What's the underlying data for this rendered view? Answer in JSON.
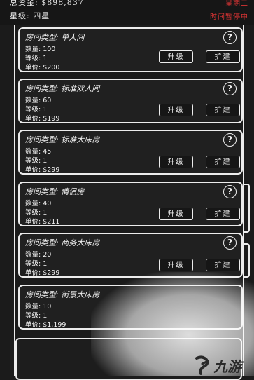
{
  "header": {
    "total_assets": "总资金: $898,837",
    "star_level": "星级: 四星",
    "weekday": "星期二",
    "time_status": "时间暂停中"
  },
  "colors": {
    "background": "#1b1b1b",
    "border": "#ececec",
    "accent_red": "#d63333"
  },
  "rooms": [
    {
      "title": "房间类型: 单人间",
      "quantity": "数量: 100",
      "level": "等级: 1",
      "price": "单价: $200",
      "upgrade": "升级",
      "expand": "扩建",
      "help": "?"
    },
    {
      "title": "房间类型: 标准双人间",
      "quantity": "数量: 60",
      "level": "等级: 1",
      "price": "单价: $199",
      "upgrade": "升级",
      "expand": "扩建",
      "help": "?"
    },
    {
      "title": "房间类型: 标准大床房",
      "quantity": "数量: 45",
      "level": "等级: 1",
      "price": "单价: $299",
      "upgrade": "升级",
      "expand": "扩建",
      "help": "?"
    },
    {
      "title": "房间类型: 情侣房",
      "quantity": "数量: 40",
      "level": "等级: 1",
      "price": "单价: $211",
      "upgrade": "升级",
      "expand": "扩建",
      "help": "?"
    },
    {
      "title": "房间类型: 商务大床房",
      "quantity": "数量: 20",
      "level": "等级: 1",
      "price": "单价: $299",
      "upgrade": "升级",
      "expand": "扩建",
      "help": "?"
    },
    {
      "title": "房间类型: 街景大床房",
      "quantity": "数量: 10",
      "level": "等级: 1",
      "price": "单价: $1,199"
    }
  ],
  "watermark": {
    "text": "九游",
    "icon": "jiuyou-logo-icon"
  }
}
